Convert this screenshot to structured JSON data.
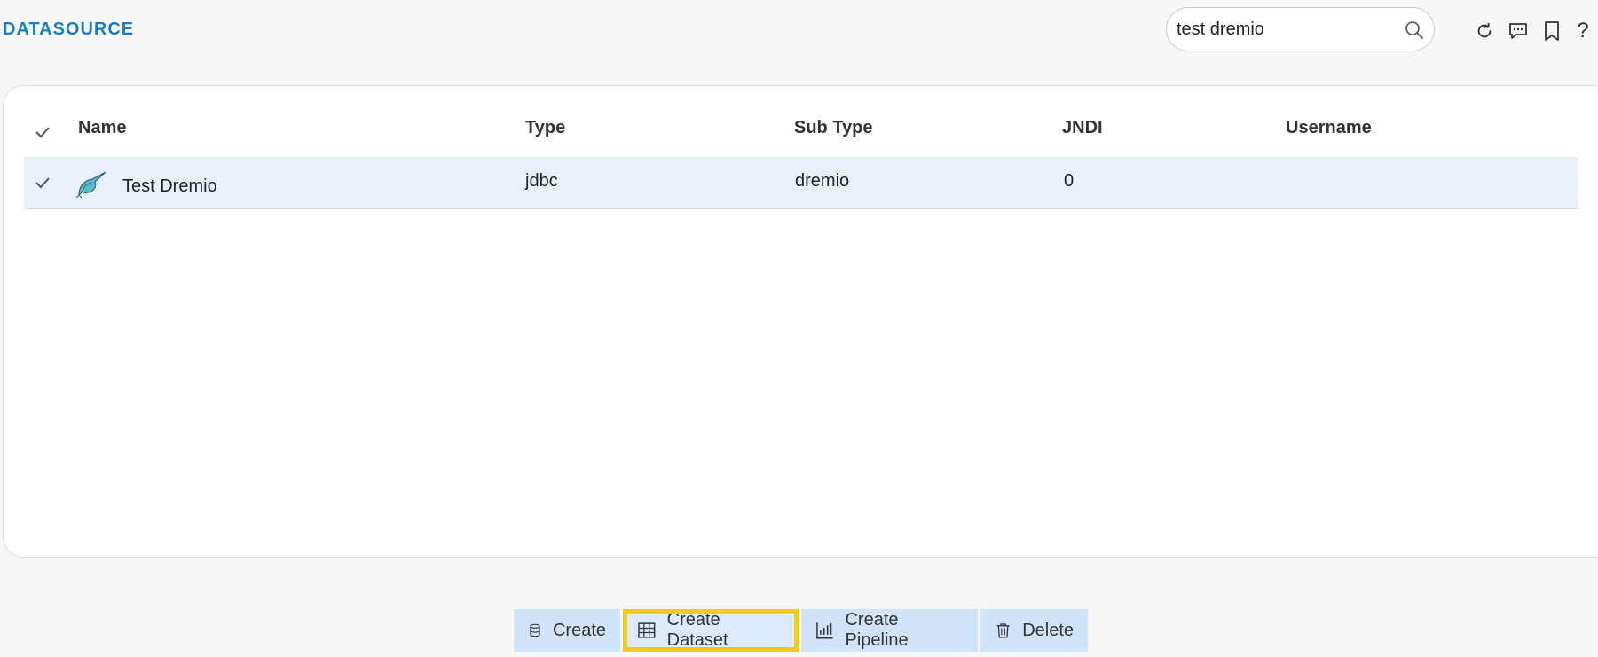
{
  "header": {
    "title": "DATASOURCE",
    "search": {
      "value": "test dremio",
      "icon": "search-icon"
    },
    "actions": [
      {
        "name": "refresh-icon"
      },
      {
        "name": "comment-icon"
      },
      {
        "name": "bookmark-icon"
      },
      {
        "name": "help-icon",
        "label": "?"
      }
    ]
  },
  "table": {
    "columns": {
      "name": "Name",
      "type": "Type",
      "sub_type": "Sub Type",
      "jndi": "JNDI",
      "username": "Username"
    },
    "rows": [
      {
        "selected": true,
        "icon": "dremio-narwhal-icon",
        "name": "Test Dremio",
        "type": "jdbc",
        "sub_type": "dremio",
        "jndi": "0",
        "username": ""
      }
    ]
  },
  "toolbar": {
    "create_label": "Create",
    "create_dataset_label": "Create Dataset",
    "create_pipeline_label": "Create Pipeline",
    "delete_label": "Delete"
  },
  "colors": {
    "accent": "#1a7fc1",
    "row_selected": "#eaf0fa",
    "toolbar_button": "#cfe3f9",
    "highlight": "#f2cd14"
  }
}
